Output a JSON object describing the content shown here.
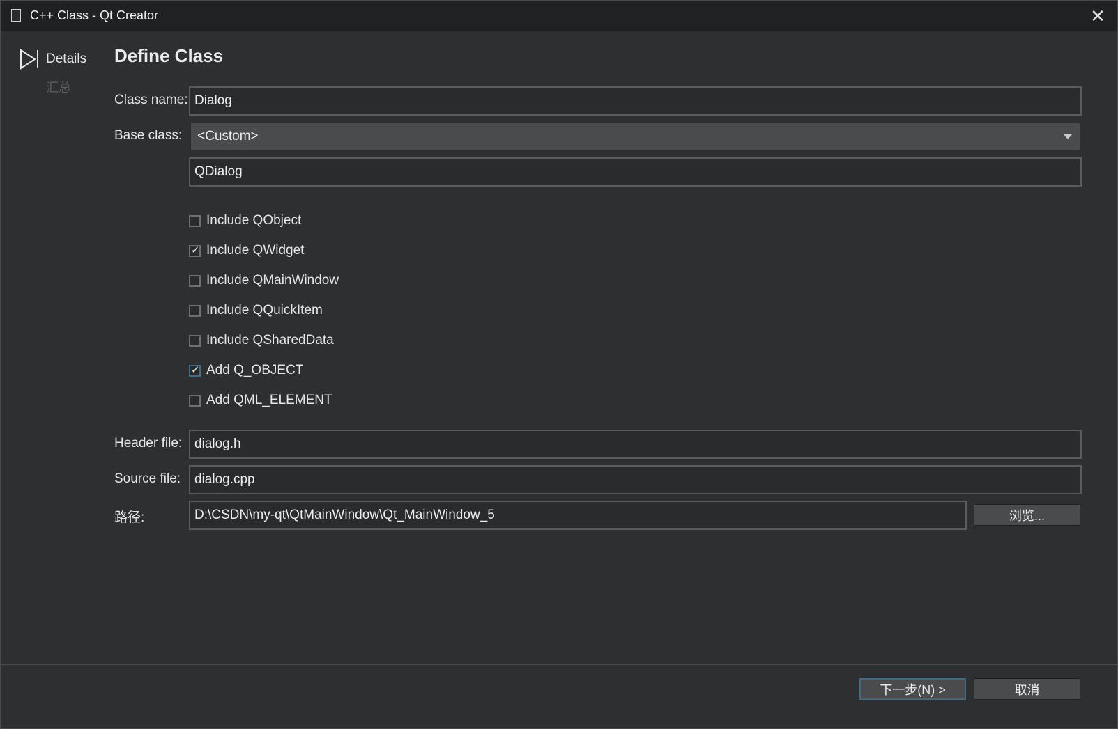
{
  "window": {
    "title": "C++ Class - Qt Creator",
    "close_symbol": "✕"
  },
  "sidebar": {
    "steps": [
      {
        "label": "Details",
        "active": true
      },
      {
        "label": "汇总",
        "active": false
      }
    ]
  },
  "page": {
    "title": "Define Class"
  },
  "form": {
    "class_name_label": "Class name:",
    "class_name_value": "Dialog",
    "base_class_label": "Base class:",
    "base_class_selected": "<Custom>",
    "custom_base_value": "QDialog",
    "header_file_label": "Header file:",
    "header_file_value": "dialog.h",
    "source_file_label": "Source file:",
    "source_file_value": "dialog.cpp",
    "path_label": "路径:",
    "path_value": "D:\\CSDN\\my-qt\\QtMainWindow\\Qt_MainWindow_5",
    "browse_label": "浏览..."
  },
  "options": [
    {
      "label": "Include QObject",
      "checked": false
    },
    {
      "label": "Include QWidget",
      "checked": true
    },
    {
      "label": "Include QMainWindow",
      "checked": false
    },
    {
      "label": "Include QQuickItem",
      "checked": false
    },
    {
      "label": "Include QSharedData",
      "checked": false
    },
    {
      "label": "Add Q_OBJECT",
      "checked": true
    },
    {
      "label": "Add QML_ELEMENT",
      "checked": false
    }
  ],
  "footer": {
    "next_label": "下一步(N) >",
    "cancel_label": "取消"
  },
  "colors": {
    "background": "#2e2f30",
    "titlebar": "#202122",
    "accent_focus": "#3f6a85"
  }
}
